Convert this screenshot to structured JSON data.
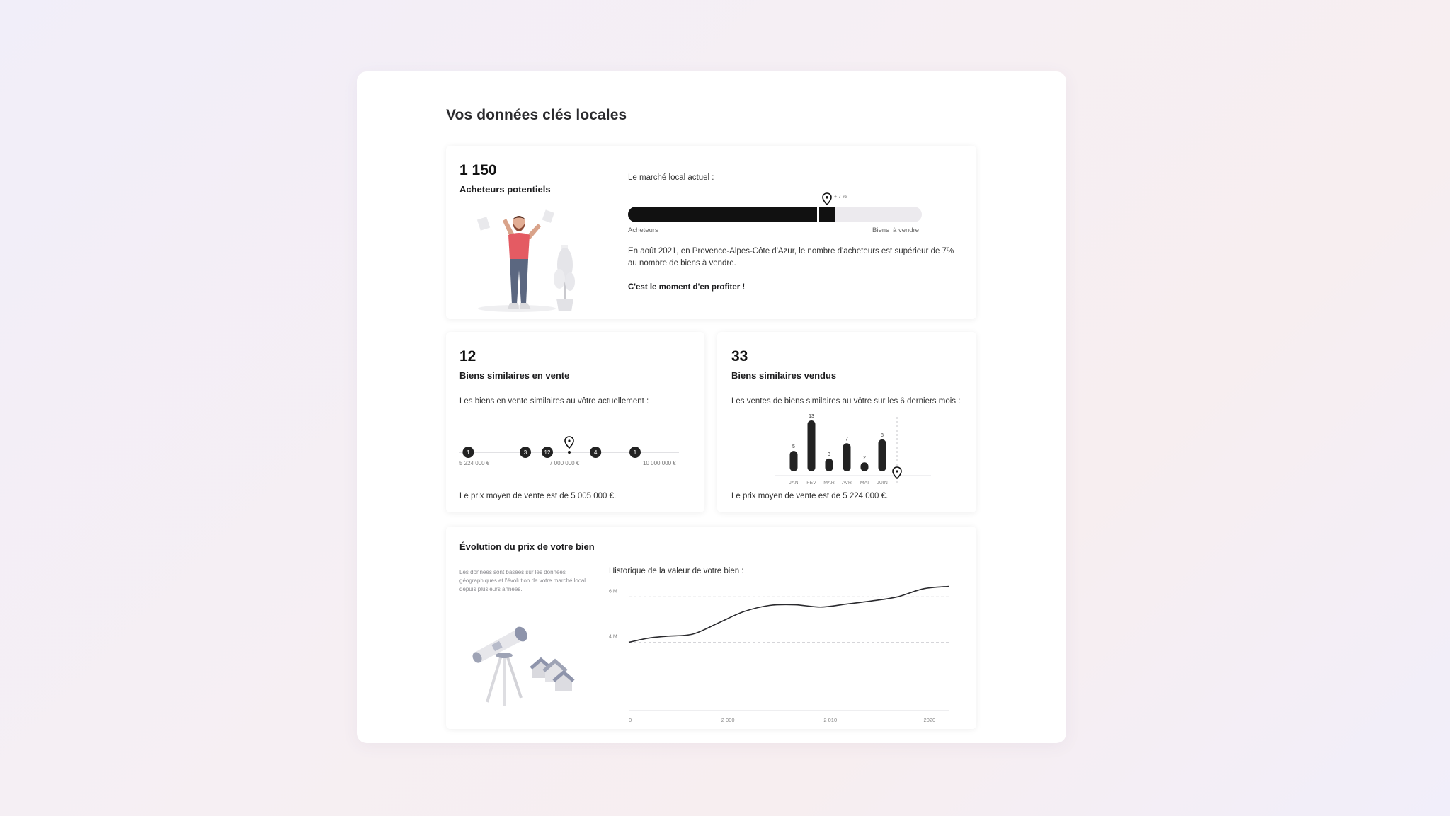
{
  "page": {
    "title": "Vos données clés locales"
  },
  "buyers_card": {
    "number": "1 150",
    "label": "Acheteurs potentiels",
    "market_label": "Le marché local actuel :",
    "pin_label": "+ 7 %",
    "bar_left_label": "Acheteurs",
    "bar_right_label": "Biens  à vendre",
    "buyers_share": 0.65,
    "description": "En août 2021, en Provence-Alpes-Côte d'Azur, le nombre d'acheteurs est supérieur de 7% au nombre de biens à vendre.",
    "cta": "C'est le moment d'en profiter !"
  },
  "on_sale_card": {
    "number": "12",
    "label": "Biens similaires en vente",
    "subtitle": "Les biens en vente similaires au vôtre actuellement :",
    "dots": [
      {
        "count": "1",
        "pos": 0.04
      },
      {
        "count": "3",
        "pos": 0.3
      },
      {
        "count": "12",
        "pos": 0.4
      },
      {
        "count": "4",
        "pos": 0.62
      },
      {
        "count": "1",
        "pos": 0.8
      }
    ],
    "pin_pos": 0.5,
    "axis_labels": [
      "5 224 000 €",
      "7 000 000 €",
      "10 000 000 €"
    ],
    "average": "Le prix moyen de vente est de 5 005 000 €."
  },
  "sold_card": {
    "number": "33",
    "label": "Biens similaires vendus",
    "subtitle": "Les ventes de biens similaires au vôtre sur les 6 derniers mois :",
    "chart_data": {
      "type": "bar",
      "categories": [
        "JAN",
        "FEV",
        "MAR",
        "AVR",
        "MAI",
        "JUIN"
      ],
      "values": [
        5,
        13,
        3,
        7,
        2,
        8
      ],
      "ylim": [
        0,
        13
      ],
      "grid": false
    },
    "average": "Le prix moyen de vente est de 5 224 000 €."
  },
  "evolution_card": {
    "title": "Évolution du prix de votre bien",
    "note": "Les données sont basées sur les données géographiques et l'évolution de votre marché local depuis plusieurs années.",
    "chart_title": "Historique de la valeur de votre bien :",
    "chart_data": {
      "type": "line",
      "x_tick_labels": [
        "0",
        "2 000",
        "2 010",
        "2020"
      ],
      "y_tick_labels": [
        "6 M",
        "4 M"
      ],
      "y_ticks": [
        6,
        4
      ],
      "ylim": [
        1,
        6.6
      ],
      "series": [
        {
          "x": [
            0,
            0.06,
            0.12,
            0.2,
            0.28,
            0.36,
            0.44,
            0.52,
            0.6,
            0.68,
            0.76,
            0.84,
            0.92,
            1.0
          ],
          "values": [
            4,
            4.18,
            4.27,
            4.36,
            4.85,
            5.35,
            5.62,
            5.65,
            5.55,
            5.68,
            5.82,
            6.0,
            6.35,
            6.46
          ]
        }
      ],
      "grid": "dashed at y ticks"
    }
  },
  "colors": {
    "ink": "#1d1d1f",
    "track": "#eceaee",
    "accent_gray": "#9ea3b5"
  }
}
